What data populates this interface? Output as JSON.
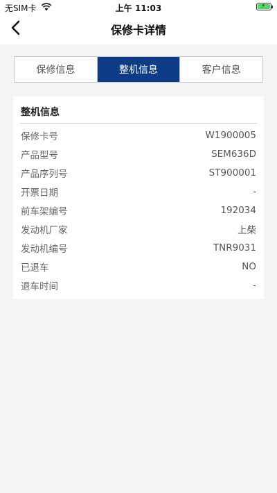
{
  "status_bar": {
    "carrier": "无SIM卡",
    "time": "上午 11:03",
    "icons": {
      "wifi": "wifi-icon",
      "battery": "battery-charging-icon"
    },
    "battery_level": 1.0,
    "battery_color": "#4cd964"
  },
  "nav": {
    "title": "保修卡详情",
    "back_icon": "chevron-left-icon"
  },
  "tabs": [
    {
      "label": "保修信息",
      "active": false
    },
    {
      "label": "整机信息",
      "active": true
    },
    {
      "label": "客户信息",
      "active": false
    }
  ],
  "colors": {
    "accent": "#0d3b86",
    "background": "#f4f4f4"
  },
  "card": {
    "title": "整机信息",
    "rows": [
      {
        "label": "保修卡号",
        "value": "W1900005"
      },
      {
        "label": "产品型号",
        "value": "SEM636D"
      },
      {
        "label": "产品序列号",
        "value": "ST900001"
      },
      {
        "label": "开票日期",
        "value": "-"
      },
      {
        "label": "前车架编号",
        "value": "192034"
      },
      {
        "label": "发动机厂家",
        "value": "上柴"
      },
      {
        "label": "发动机编号",
        "value": "TNR9031"
      },
      {
        "label": "已退车",
        "value": "NO"
      },
      {
        "label": "退车时间",
        "value": "-"
      }
    ]
  }
}
